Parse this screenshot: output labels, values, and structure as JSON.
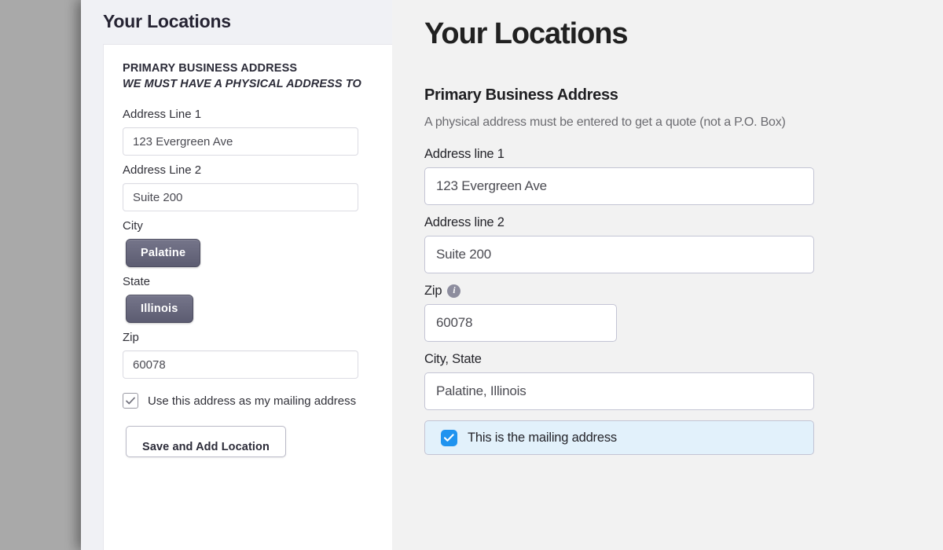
{
  "colors": {
    "backdrop": "#a9a9a9",
    "old_panel_bg": "#f0f1f5",
    "old_card_bg": "#ffffff",
    "old_pill_top": "#75758a",
    "old_pill_bottom": "#5c5c71",
    "new_panel_bg": "#f2f2f2",
    "new_input_border": "#c3c4d4",
    "new_checkbox_accent": "#1f93ef",
    "new_check_row_bg": "#e2f1fb",
    "info_icon_bg": "#8d8d9e",
    "heading_text": "#212121",
    "muted_text": "#6b6b70"
  },
  "old_panel": {
    "page_title": "Your Locations",
    "section_title": "PRIMARY BUSINESS ADDRESS",
    "section_subtitle": "WE MUST HAVE A PHYSICAL ADDRESS TO",
    "fields": [
      {
        "label": "Address Line 1",
        "value": "123 Evergreen Ave",
        "type": "text"
      },
      {
        "label": "Address Line 2",
        "value": "Suite 200",
        "type": "text"
      },
      {
        "label": "City",
        "value": "Palatine",
        "type": "pill"
      },
      {
        "label": "State",
        "value": "Illinois",
        "type": "pill"
      },
      {
        "label": "Zip",
        "value": "60078",
        "type": "text"
      }
    ],
    "checkbox": {
      "label": "Use this address as my mailing address",
      "checked": true,
      "icon": "check-icon"
    },
    "save_button_label": "Save and Add Location"
  },
  "new_panel": {
    "page_title": "Your Locations",
    "section_title": "Primary Business Address",
    "section_subtitle": "A physical address must be entered to get a quote (not a P.O. Box)",
    "fields": [
      {
        "label": "Address line 1",
        "value": "123 Evergreen Ave",
        "info_icon": false
      },
      {
        "label": "Address line 2",
        "value": "Suite 200",
        "info_icon": false
      },
      {
        "label": "Zip",
        "value": "60078",
        "info_icon": true,
        "info_icon_name": "info-icon",
        "info_icon_glyph": "i"
      },
      {
        "label": "City, State",
        "value": "Palatine, Illinois",
        "info_icon": false
      }
    ],
    "checkbox": {
      "label": "This is the mailing address",
      "checked": true,
      "icon": "check-icon"
    }
  }
}
